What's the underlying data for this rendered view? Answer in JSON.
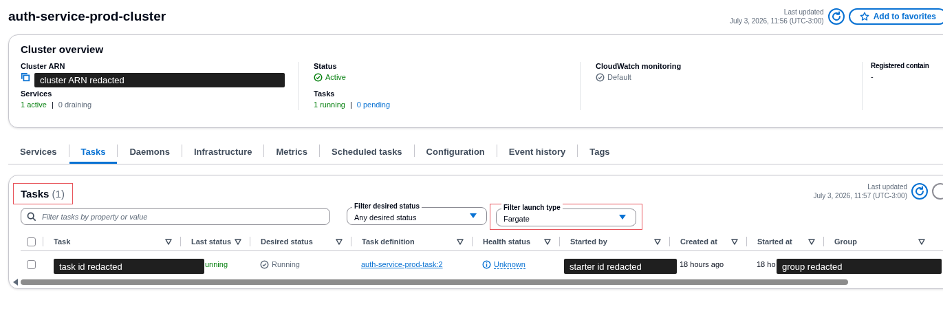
{
  "header": {
    "title": "auth-service-prod-cluster",
    "last_updated_label": "Last updated",
    "last_updated": "July 3, 2026, 11:56 (UTC-3:00)",
    "favorite_button": "Add to favorites"
  },
  "overview": {
    "title": "Cluster overview",
    "columns": [
      [
        {
          "label": "Cluster ARN",
          "kind": "redacted",
          "value": "cluster ARN redacted"
        },
        {
          "label": "Services",
          "kind": "counts",
          "separator": "|",
          "parts": [
            {
              "text": "1 active",
              "kind": "success"
            },
            {
              "text": "0 draining",
              "kind": "muted"
            }
          ]
        }
      ],
      [
        {
          "label": "Status",
          "kind": "success_status",
          "value": "Active"
        },
        {
          "label": "Tasks",
          "kind": "counts",
          "separator": "|",
          "parts": [
            {
              "text": "1 running",
              "kind": "success"
            },
            {
              "text": "0 pending",
              "kind": "link"
            }
          ]
        }
      ],
      [
        {
          "label": "CloudWatch monitoring",
          "kind": "muted_status",
          "value": "Default"
        }
      ],
      [
        {
          "label": "Registered contain",
          "kind": "plain",
          "value": "-"
        }
      ]
    ]
  },
  "tabs": [
    {
      "label": "Services",
      "selected": false
    },
    {
      "label": "Tasks",
      "selected": true
    },
    {
      "label": "Daemons",
      "selected": false
    },
    {
      "label": "Infrastructure",
      "selected": false
    },
    {
      "label": "Metrics",
      "selected": false
    },
    {
      "label": "Scheduled tasks",
      "selected": false
    },
    {
      "label": "Configuration",
      "selected": false
    },
    {
      "label": "Event history",
      "selected": false
    },
    {
      "label": "Tags",
      "selected": false
    }
  ],
  "tasks_panel": {
    "title": "Tasks",
    "count": "(1)",
    "highlighted": true,
    "last_updated_label": "Last updated",
    "last_updated": "July 3, 2026, 11:57 (UTC-3:00)",
    "search": {
      "placeholder": "Filter tasks by property or value"
    },
    "filters": [
      {
        "label": "Filter desired status",
        "value": "Any desired status",
        "highlighted": false
      },
      {
        "label": "Filter launch type",
        "value": "Fargate",
        "highlighted": true
      }
    ],
    "table": {
      "columns": [
        "Task",
        "Last status",
        "Desired status",
        "Task definition",
        "Health status",
        "Started by",
        "Created at",
        "Started at",
        "Group"
      ],
      "select_all_checked": false,
      "rows": [
        {
          "checked": false,
          "cells": [
            {
              "kind": "redacted",
              "text": "task id redacted"
            },
            {
              "kind": "success_text",
              "text": "unning"
            },
            {
              "kind": "check_status",
              "text": "Running"
            },
            {
              "kind": "link",
              "text": "auth-service-prod-task:2"
            },
            {
              "kind": "info_status",
              "text": "Unknown"
            },
            {
              "kind": "redacted",
              "text": "starter id redacted"
            },
            {
              "kind": "text",
              "text": "18 hours ago"
            },
            {
              "kind": "text",
              "text": "18 ho"
            },
            {
              "kind": "redacted",
              "text": "group redacted"
            }
          ]
        }
      ]
    }
  }
}
